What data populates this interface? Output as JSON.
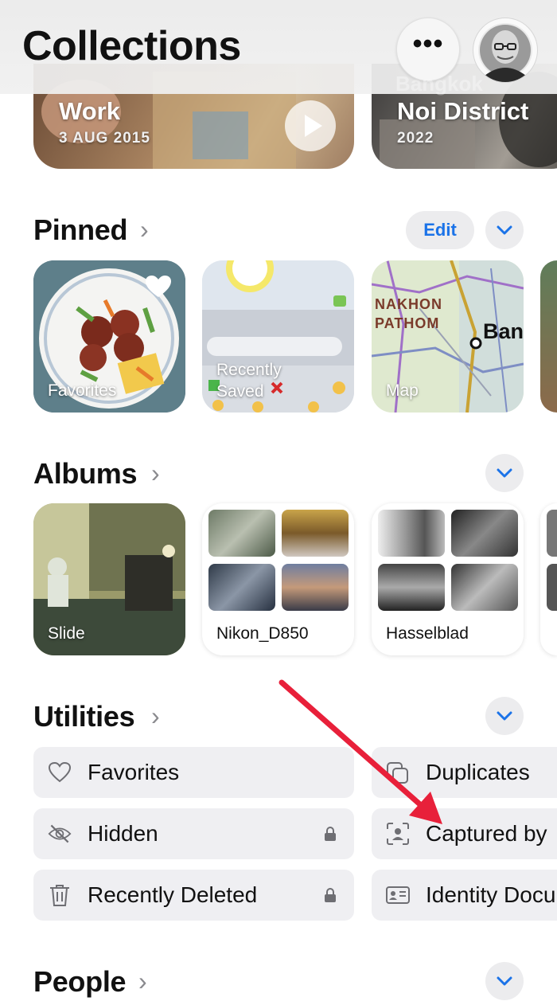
{
  "header": {
    "title": "Collections",
    "more_icon": "ellipsis-icon",
    "more_label": "•••",
    "avatar_icon": "profile-avatar"
  },
  "memories": [
    {
      "title": "Work",
      "date": "3 AUG 2015",
      "play_icon": "play-icon"
    },
    {
      "title": "Noi District",
      "date": "2022",
      "overlay_text": "Bangkok"
    }
  ],
  "pinned": {
    "title": "Pinned",
    "edit_label": "Edit",
    "items": [
      {
        "label": "Favorites",
        "icon": "heart-icon"
      },
      {
        "label": "Recently\nSaved"
      },
      {
        "label": "Map",
        "map_text_1": "NAKHON",
        "map_text_2": "PATHOM",
        "map_text_3": "Ban"
      }
    ]
  },
  "albums": {
    "title": "Albums",
    "items": [
      {
        "label": "Slide"
      },
      {
        "label": "Nikon_D850"
      },
      {
        "label": "Hasselblad"
      }
    ]
  },
  "utilities": {
    "title": "Utilities",
    "items": [
      {
        "label": "Favorites",
        "icon": "heart-outline-icon",
        "locked": false
      },
      {
        "label": "Duplicates",
        "icon": "duplicates-icon",
        "locked": false
      },
      {
        "label": "Hidden",
        "icon": "eye-slash-icon",
        "locked": true
      },
      {
        "label": "Captured by",
        "icon": "person-viewfinder-icon",
        "locked": false
      },
      {
        "label": "Recently Deleted",
        "icon": "trash-icon",
        "locked": true
      },
      {
        "label": "Identity Docu",
        "icon": "id-card-icon",
        "locked": false
      }
    ]
  },
  "people": {
    "title": "People"
  },
  "colors": {
    "accent_blue": "#1b73e8",
    "annotation_red": "#e8203a",
    "chip_bg": "#ececee",
    "utility_bg": "#efeff2"
  }
}
